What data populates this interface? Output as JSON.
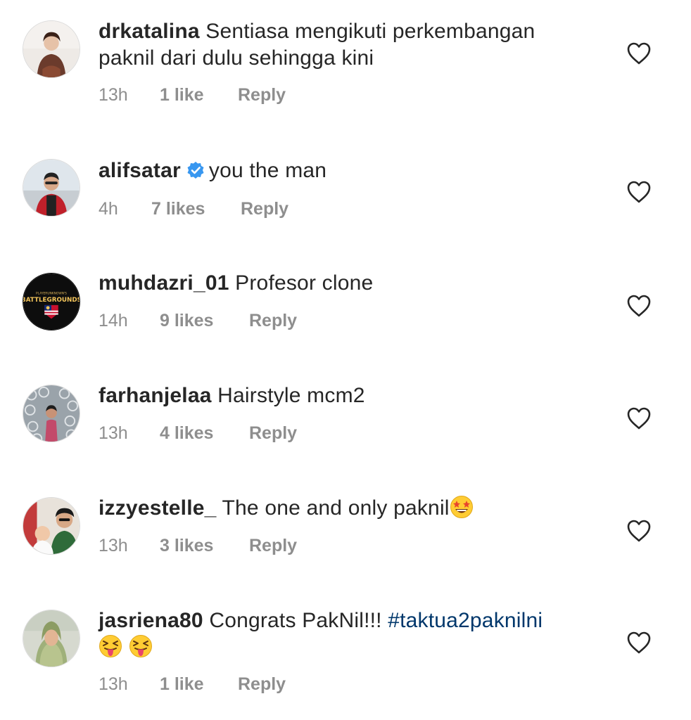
{
  "comments": [
    {
      "username": "drkatalina",
      "text_line1": "Sentiasa mengikuti perkembangan",
      "text_line2": "paknil dari dulu sehingga kini",
      "time": "13h",
      "likes": "1 like",
      "reply": "Reply"
    },
    {
      "username": "alifsatar",
      "verified": true,
      "text": "you the man",
      "time": "4h",
      "likes": "7 likes",
      "reply": "Reply"
    },
    {
      "username": "muhdazri_01",
      "text": "Profesor clone",
      "time": "14h",
      "likes": "9 likes",
      "reply": "Reply",
      "avatar_text_top": "PLAYERUNKNOWN'S",
      "avatar_text": "BATTLEGROUNDS"
    },
    {
      "username": "farhanjelaa",
      "text": "Hairstyle mcm2",
      "time": "13h",
      "likes": "4 likes",
      "reply": "Reply"
    },
    {
      "username": "izzyestelle_",
      "text": "The one and only paknil",
      "emoji": "star-struck-emoji",
      "time": "13h",
      "likes": "3 likes",
      "reply": "Reply"
    },
    {
      "username": "jasriena80",
      "text": "Congrats PakNil!!!",
      "hashtag": "#taktua2paknilni",
      "emoji": "squinting-tongue-emoji",
      "time": "13h",
      "likes": "1 like",
      "reply": "Reply"
    }
  ],
  "colors": {
    "text": "#262626",
    "meta": "#8e8e8e",
    "hashtag": "#00376b",
    "verified": "#3897f0"
  }
}
